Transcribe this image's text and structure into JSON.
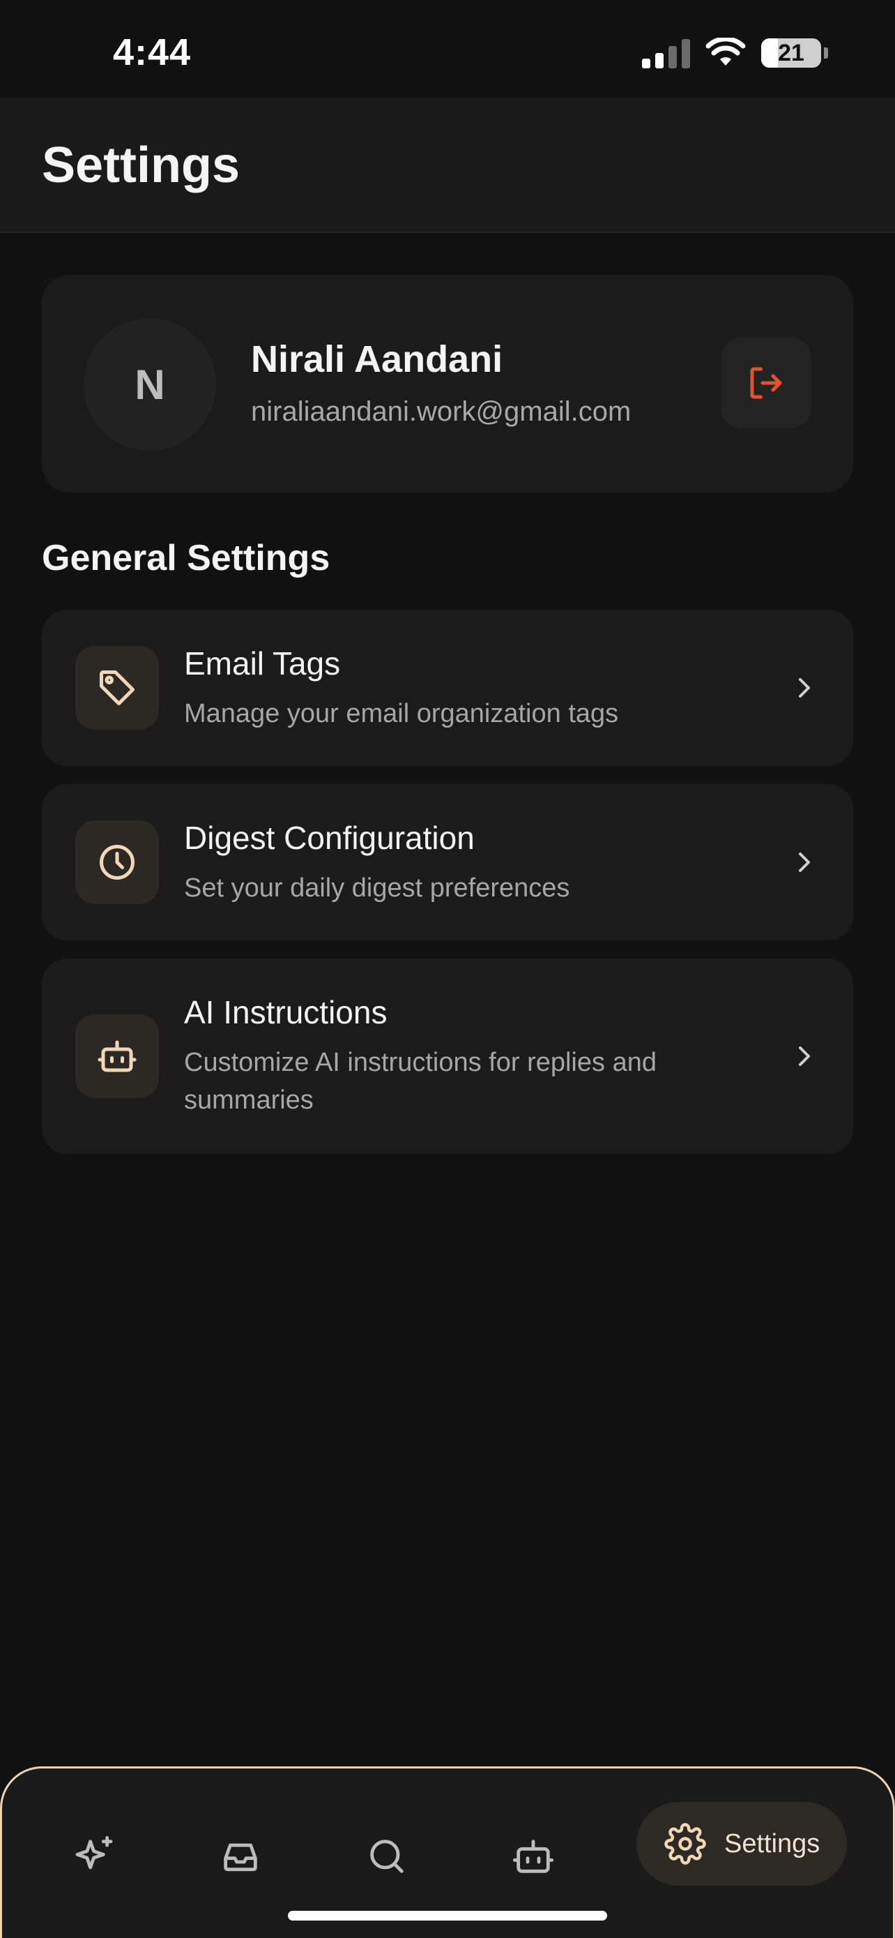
{
  "status_bar": {
    "time": "4:44",
    "battery": "21"
  },
  "header": {
    "title": "Settings"
  },
  "profile": {
    "initial": "N",
    "name": "Nirali Aandani",
    "email": "niraliaandani.work@gmail.com",
    "logout_icon": "logout-icon"
  },
  "general_settings": {
    "title": "General Settings",
    "items": [
      {
        "title": "Email Tags",
        "description": "Manage your email organization tags",
        "icon": "tag-icon"
      },
      {
        "title": "Digest Configuration",
        "description": "Set your daily digest preferences",
        "icon": "clock-icon"
      },
      {
        "title": "AI Instructions",
        "description": "Customize AI instructions for replies and summaries",
        "icon": "robot-icon"
      }
    ]
  },
  "bottom_nav": {
    "items": [
      {
        "icon": "sparkles-icon"
      },
      {
        "icon": "inbox-icon"
      },
      {
        "icon": "search-icon"
      },
      {
        "icon": "robot-icon"
      },
      {
        "icon": "gear-icon",
        "label": "Settings",
        "active": true
      }
    ]
  },
  "colors": {
    "background": "#111111",
    "card": "#1b1b1b",
    "accent": "#f0d7b5",
    "logout": "#e0532f"
  }
}
